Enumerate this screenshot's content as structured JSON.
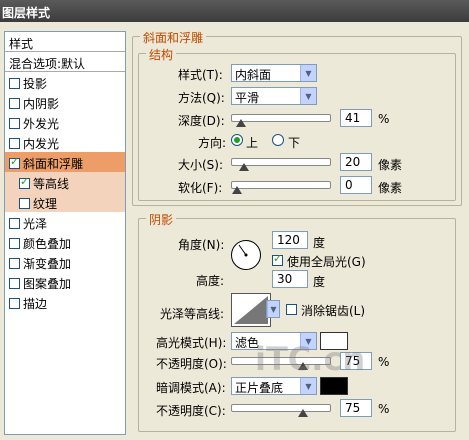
{
  "window": {
    "title": "图层样式"
  },
  "sidebar": {
    "styles_header": "样式",
    "blend_header": "混合选项:默认",
    "items": [
      {
        "label": "投影",
        "checked": false
      },
      {
        "label": "内阴影",
        "checked": false
      },
      {
        "label": "外发光",
        "checked": false
      },
      {
        "label": "内发光",
        "checked": false
      },
      {
        "label": "斜面和浮雕",
        "checked": true,
        "selected": true
      },
      {
        "label": "等高线",
        "checked": true,
        "sub": true
      },
      {
        "label": "纹理",
        "checked": false,
        "sub": true
      },
      {
        "label": "光泽",
        "checked": false
      },
      {
        "label": "颜色叠加",
        "checked": false
      },
      {
        "label": "渐变叠加",
        "checked": false
      },
      {
        "label": "图案叠加",
        "checked": false
      },
      {
        "label": "描边",
        "checked": false
      }
    ]
  },
  "bevel": {
    "group_title": "斜面和浮雕",
    "structure_title": "结构",
    "style_label": "样式(T):",
    "style_value": "内斜面",
    "method_label": "方法(Q):",
    "method_value": "平滑",
    "depth_label": "深度(D):",
    "depth_value": "41",
    "depth_unit": "%",
    "depth_level": 0.041,
    "direction_label": "方向:",
    "dir_up": "上",
    "dir_down": "下",
    "dir_selected": "up",
    "size_label": "大小(S):",
    "size_value": "20",
    "size_unit": "像素",
    "size_level": 0.08,
    "soften_label": "软化(F):",
    "soften_value": "0",
    "soften_unit": "像素",
    "soften_level": 0
  },
  "shading": {
    "title": "阴影",
    "angle_label": "角度(N):",
    "angle_value": "120",
    "angle_unit": "度",
    "global_light_label": "使用全局光(G)",
    "global_light_checked": true,
    "altitude_label": "高度:",
    "altitude_value": "30",
    "altitude_unit": "度",
    "gloss_label": "光泽等高线:",
    "antialias_label": "消除锯齿(L)",
    "antialias_checked": false,
    "highlight_label": "高光模式(H):",
    "highlight_mode": "滤色",
    "highlight_color": "#ffffff",
    "highlight_opacity_label": "不透明度(O):",
    "highlight_opacity": "75",
    "highlight_opacity_unit": "%",
    "shadow_label": "暗调模式(A):",
    "shadow_mode": "正片叠底",
    "shadow_color": "#000000",
    "shadow_opacity_label": "不透明度(C):",
    "shadow_opacity": "75",
    "shadow_opacity_unit": "%"
  },
  "watermark": "iTC.cn",
  "colors": {
    "selected": "#ed9d68",
    "subselected": "#f4d3bc",
    "group_title": "#c14a00",
    "title_bar": "#4a4a4a"
  }
}
